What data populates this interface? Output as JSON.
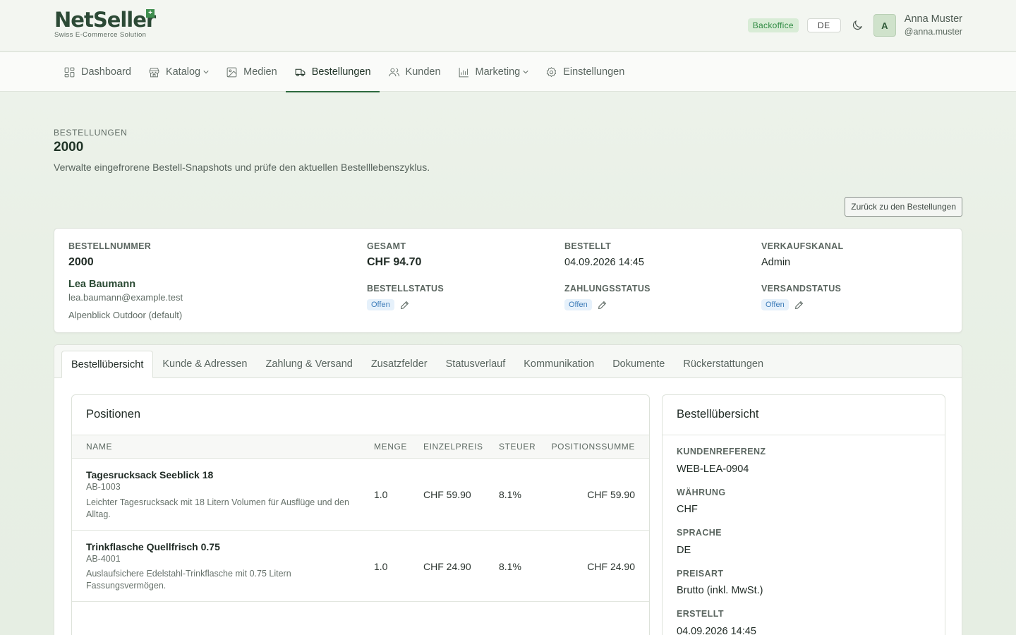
{
  "brand": {
    "name_part1": "Net",
    "name_part2": "Seller",
    "badge": "+",
    "tagline": "Swiss E-Commerce Solution"
  },
  "header": {
    "environment_badge": "Backoffice",
    "language": "DE",
    "avatar_initial": "A",
    "user_name": "Anna Muster",
    "user_handle": "@anna.muster"
  },
  "nav": [
    {
      "label": "Dashboard",
      "icon": "dashboard-icon"
    },
    {
      "label": "Katalog",
      "icon": "store-icon",
      "dropdown": true
    },
    {
      "label": "Medien",
      "icon": "image-icon"
    },
    {
      "label": "Bestellungen",
      "icon": "truck-icon",
      "active": true
    },
    {
      "label": "Kunden",
      "icon": "users-icon"
    },
    {
      "label": "Marketing",
      "icon": "chart-icon",
      "dropdown": true
    },
    {
      "label": "Einstellungen",
      "icon": "gear-icon"
    }
  ],
  "page": {
    "eyebrow": "BESTELLUNGEN",
    "title": "2000",
    "description": "Verwalte eingefrorene Bestell-Snapshots und prüfe den aktuellen Bestelllebenszyklus.",
    "back_button": "Zurück zu den Bestellungen"
  },
  "summary": {
    "order_number_label": "BESTELLNUMMER",
    "order_number": "2000",
    "customer_name": "Lea Baumann",
    "customer_email": "lea.baumann@example.test",
    "shop": "Alpenblick Outdoor (default)",
    "total_label": "GESAMT",
    "total": "CHF 94.70",
    "ordered_label": "BESTELLT",
    "ordered": "04.09.2026 14:45",
    "channel_label": "VERKAUFSKANAL",
    "channel": "Admin",
    "order_status_label": "BESTELLSTATUS",
    "order_status": "Offen",
    "payment_status_label": "ZAHLUNGSSTATUS",
    "payment_status": "Offen",
    "shipping_status_label": "VERSANDSTATUS",
    "shipping_status": "Offen"
  },
  "tabs": [
    "Bestellübersicht",
    "Kunde & Adressen",
    "Zahlung & Versand",
    "Zusatzfelder",
    "Statusverlauf",
    "Kommunikation",
    "Dokumente",
    "Rückerstattungen"
  ],
  "positions": {
    "title": "Positionen",
    "columns": [
      "NAME",
      "MENGE",
      "EINZELPREIS",
      "STEUER",
      "POSITIONSSUMME"
    ],
    "rows": [
      {
        "name": "Tagesrucksack Seeblick 18",
        "sku": "AB-1003",
        "description": "Leichter Tagesrucksack mit 18 Litern Volumen für Ausflüge und den Alltag.",
        "qty": "1.0",
        "unit_price": "CHF 59.90",
        "tax": "8.1%",
        "total": "CHF 59.90"
      },
      {
        "name": "Trinkflasche Quellfrisch 0.75",
        "sku": "AB-4001",
        "description": "Auslaufsichere Edelstahl-Trinkflasche mit 0.75 Litern Fassungsvermögen.",
        "qty": "1.0",
        "unit_price": "CHF 24.90",
        "tax": "8.1%",
        "total": "CHF 24.90"
      }
    ]
  },
  "overview": {
    "title": "Bestellübersicht",
    "fields": [
      {
        "label": "KUNDENREFERENZ",
        "value": "WEB-LEA-0904"
      },
      {
        "label": "WÄHRUNG",
        "value": "CHF"
      },
      {
        "label": "SPRACHE",
        "value": "DE"
      },
      {
        "label": "PREISART",
        "value": "Brutto (inkl. MwSt.)"
      },
      {
        "label": "ERSTELLT",
        "value": "04.09.2026 14:45"
      }
    ]
  }
}
